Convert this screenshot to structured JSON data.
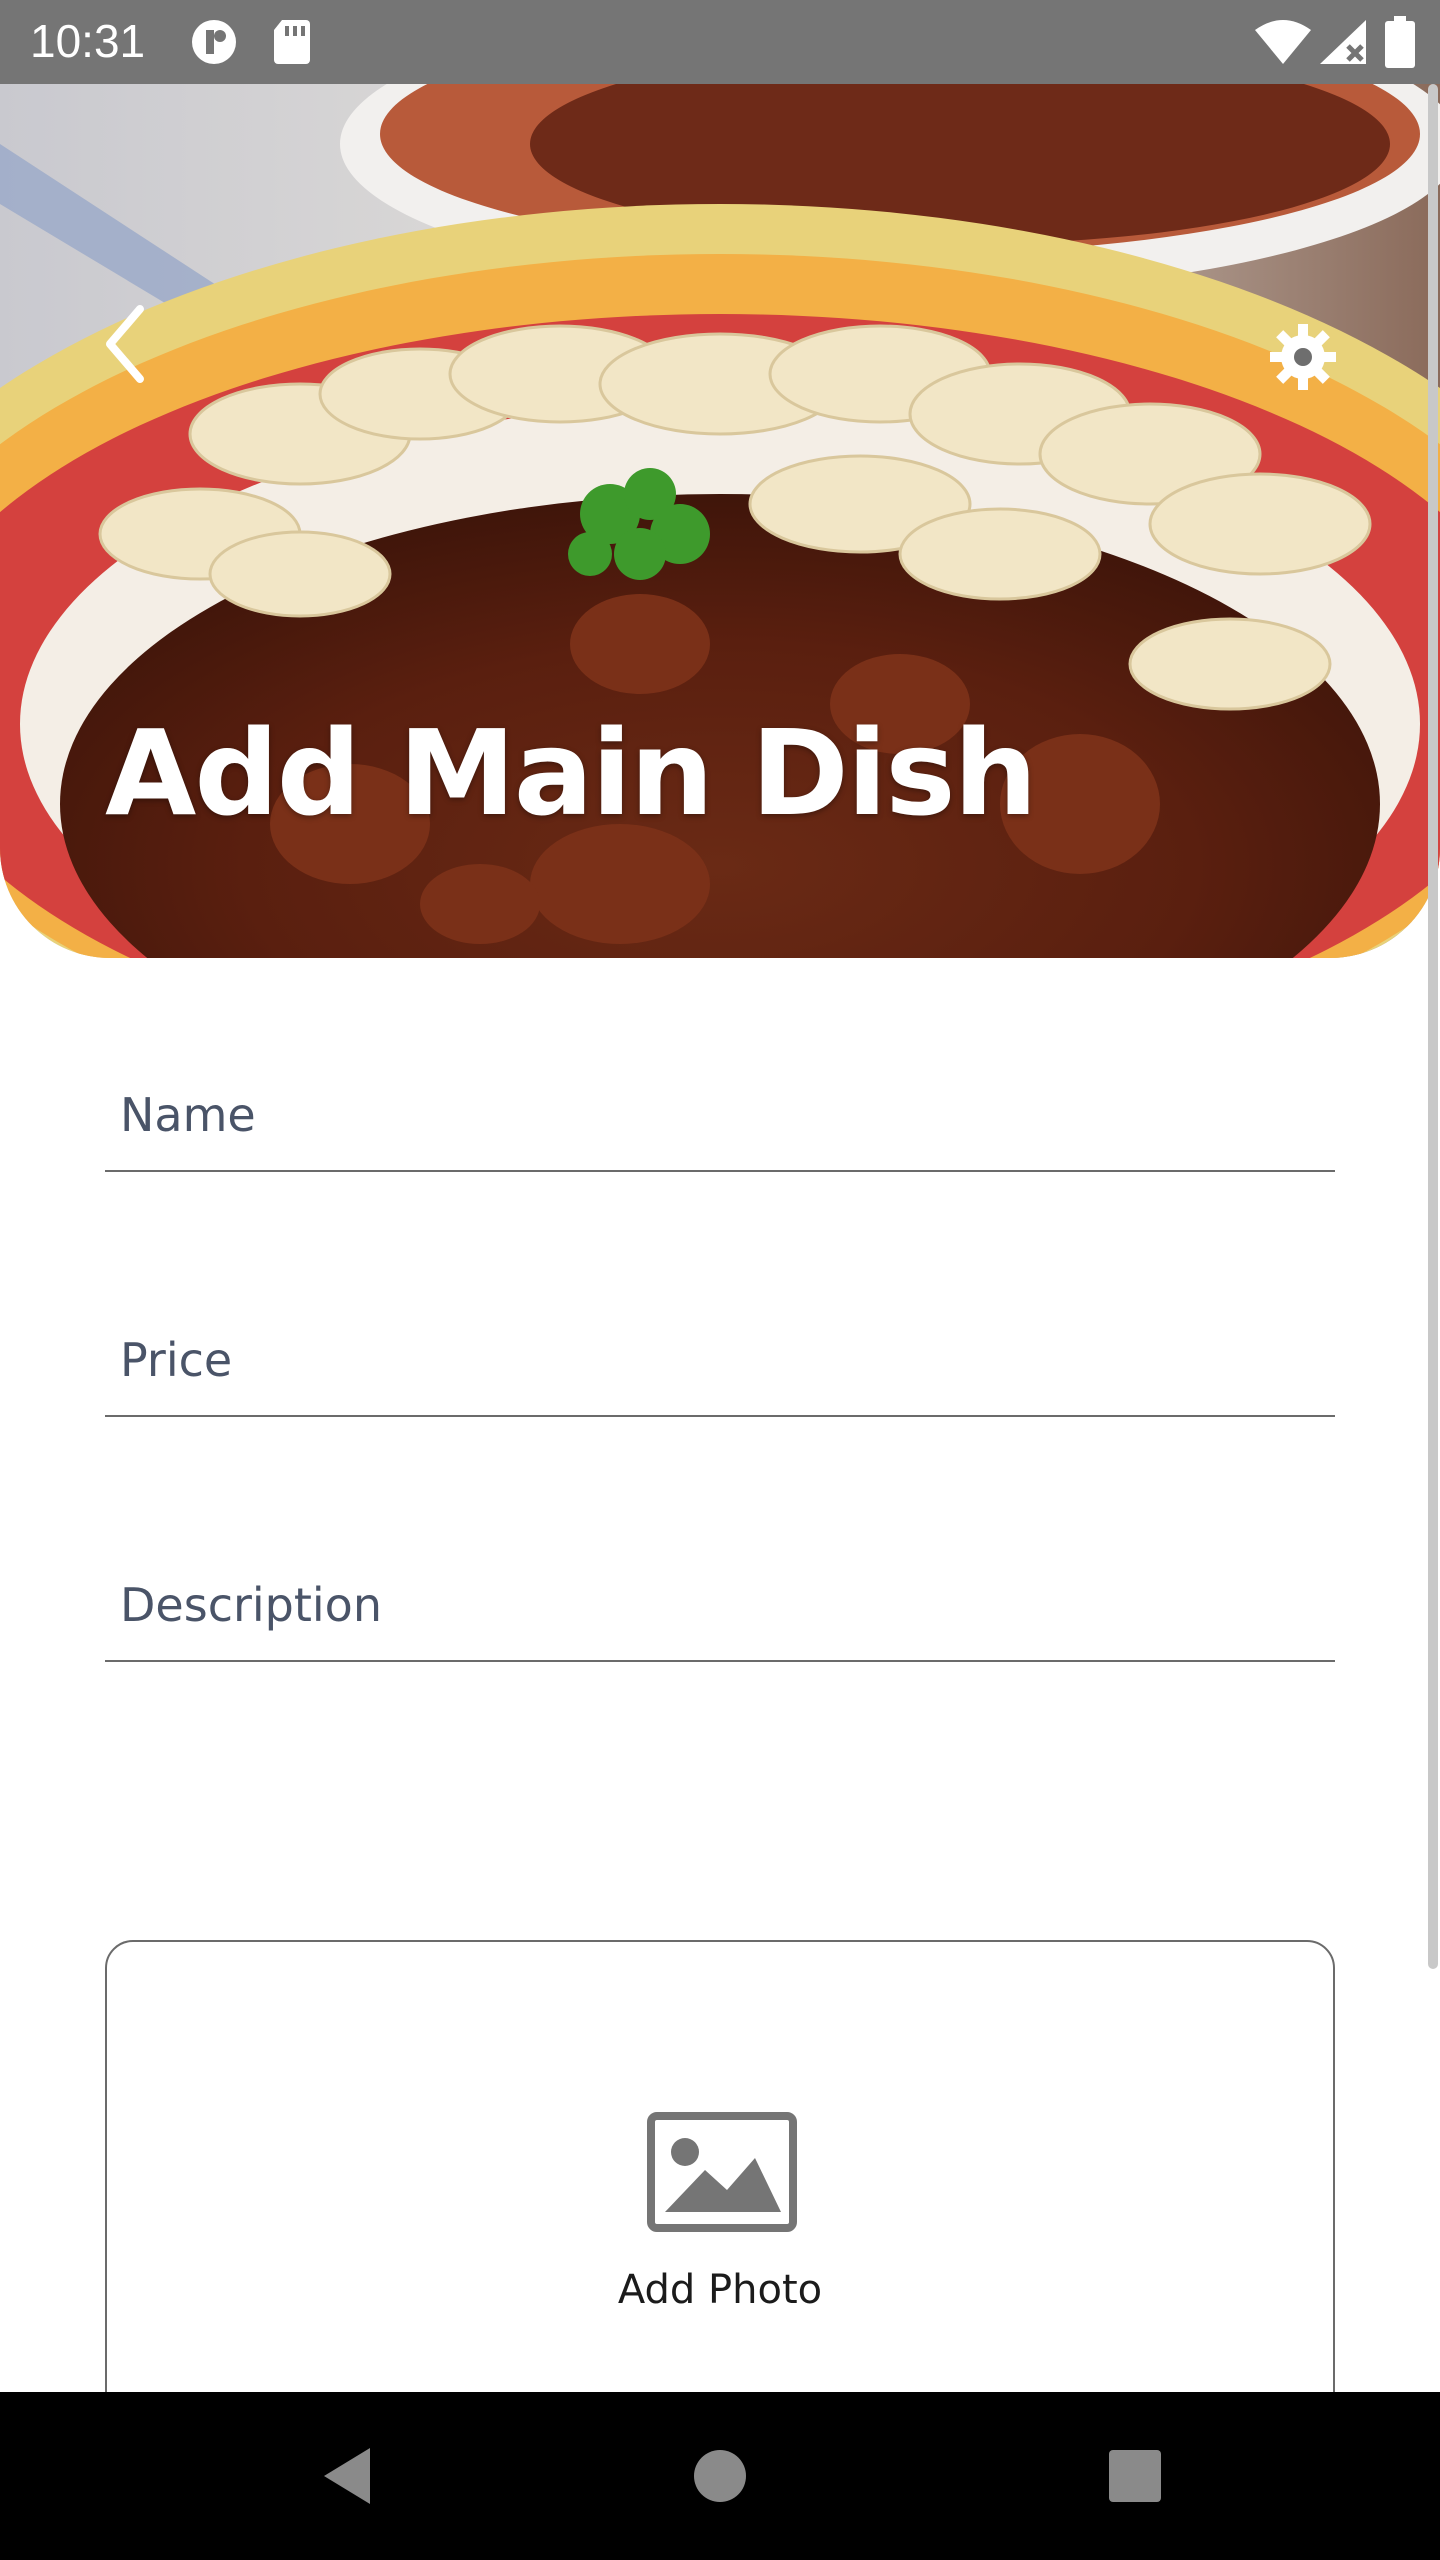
{
  "status_bar": {
    "time": "10:31",
    "icons": [
      "data-saver-icon",
      "sd-card-icon",
      "wifi-icon",
      "cellular-no-data-icon",
      "battery-icon"
    ]
  },
  "header": {
    "title": "Add Main Dish",
    "back_icon": "chevron-left-icon",
    "settings_icon": "gear-icon"
  },
  "form": {
    "name": {
      "placeholder": "Name",
      "value": ""
    },
    "price": {
      "placeholder": "Price",
      "value": ""
    },
    "description": {
      "placeholder": "Description",
      "value": ""
    }
  },
  "photo": {
    "label": "Add Photo",
    "icon": "image-icon"
  },
  "nav_bar": {
    "buttons": [
      "back-triangle-icon",
      "home-circle-icon",
      "recents-square-icon"
    ]
  },
  "colors": {
    "status_bar": "#757575",
    "nav_bar": "#000000",
    "placeholder": "#4a5468",
    "title": "#ffffff"
  }
}
